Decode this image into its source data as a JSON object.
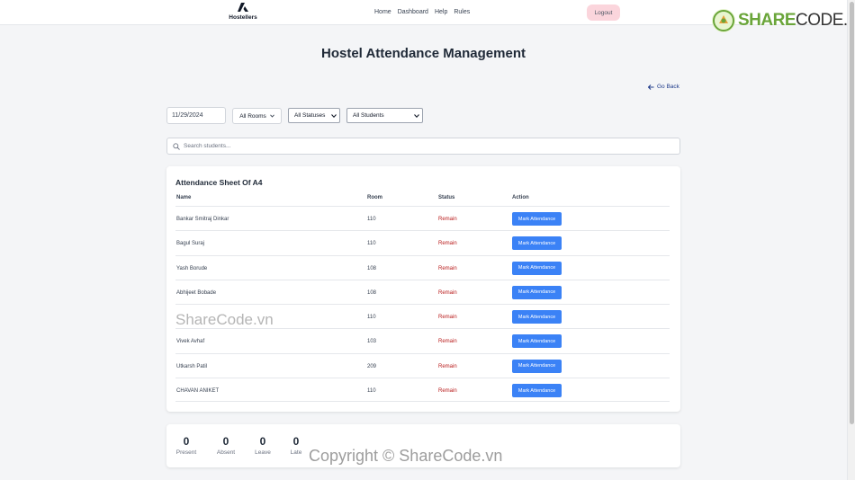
{
  "navbar": {
    "brand": "Hostellers",
    "links": [
      "Home",
      "Dashboard",
      "Help",
      "Rules"
    ],
    "logout": "Logout"
  },
  "watermark": {
    "logo_part1": "SHARE",
    "logo_part2": "CODE.vn",
    "overlay_mid": "ShareCode.vn",
    "overlay_bottom": "Copyright © ShareCode.vn"
  },
  "page": {
    "title": "Hostel Attendance Management",
    "go_back": "Go Back"
  },
  "filters": {
    "date": "11/29/2024",
    "rooms": "All Rooms",
    "statuses": "All Statuses",
    "students": "All Students"
  },
  "search": {
    "placeholder": "Search students..."
  },
  "sheet": {
    "title": "Attendance Sheet Of A4",
    "headers": {
      "name": "Name",
      "room": "Room",
      "status": "Status",
      "action": "Action"
    },
    "button_label": "Mark Attendance",
    "rows": [
      {
        "name": "Bankar Smitraj Dinkar",
        "room": "110",
        "status": "Remain"
      },
      {
        "name": "Bagul Suraj",
        "room": "110",
        "status": "Remain"
      },
      {
        "name": "Yash Borude",
        "room": "108",
        "status": "Remain"
      },
      {
        "name": "Abhijeet Bobade",
        "room": "108",
        "status": "Remain"
      },
      {
        "name": "",
        "room": "110",
        "status": "Remain"
      },
      {
        "name": "Vivek Avhaf",
        "room": "103",
        "status": "Remain"
      },
      {
        "name": "Utkarsh Patil",
        "room": "209",
        "status": "Remain"
      },
      {
        "name": "CHAVAN ANIKET",
        "room": "110",
        "status": "Remain"
      }
    ]
  },
  "stats": [
    {
      "value": "0",
      "label": "Present"
    },
    {
      "value": "0",
      "label": "Absent"
    },
    {
      "value": "0",
      "label": "Leave"
    },
    {
      "value": "0",
      "label": "Late"
    }
  ],
  "colors": {
    "primary_button": "#3b82f6",
    "status_remain": "#b91c1c",
    "logout_bg": "#fbd5dc"
  }
}
